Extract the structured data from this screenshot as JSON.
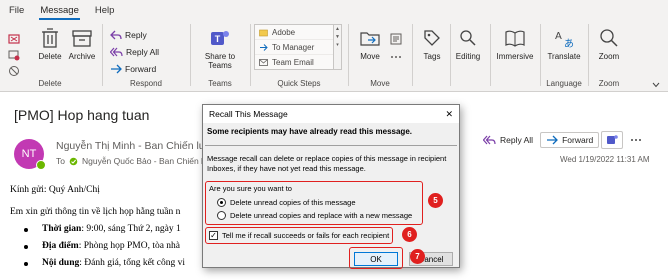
{
  "menu": {
    "tabs": [
      "File",
      "Message",
      "Help"
    ],
    "active": "Message"
  },
  "ribbon": {
    "delete_group": {
      "label": "Delete",
      "delete": "Delete",
      "archive": "Archive"
    },
    "respond_group": {
      "label": "Respond",
      "reply": "Reply",
      "reply_all": "Reply All",
      "forward": "Forward"
    },
    "teams_group": {
      "label": "Teams",
      "share_line1": "Share to",
      "share_line2": "Teams"
    },
    "quick_steps": {
      "label": "Quick Steps",
      "items": [
        "Adobe",
        "To Manager",
        "Team Email"
      ]
    },
    "move_group": {
      "label": "Move",
      "move": "Move"
    },
    "tags": {
      "label": "Tags"
    },
    "editing": {
      "label": "Editing"
    },
    "immersive": {
      "label": "Immersive"
    },
    "language_group": {
      "label": "Language",
      "translate": "Translate"
    },
    "zoom_group": {
      "label": "Zoom",
      "zoom": "Zoom"
    }
  },
  "message": {
    "subject": "[PMO] Hop hang tuan",
    "avatar_initials": "NT",
    "sender": "Nguyễn Thị Minh - Ban Chiến lược",
    "to_label": "To",
    "to_recipient": "Nguyễn Quốc Bảo - Ban Chiến lược",
    "actions": {
      "reply_all": "Reply All",
      "forward": "Forward"
    },
    "datetime": "Wed 1/19/2022 11:31 AM",
    "body": {
      "greeting": "Kính gửi: Quý Anh/Chị",
      "intro": "Em xin gửi thông tin về lịch họp hằng tuần n",
      "bullets": [
        {
          "label": "Thời gian",
          "text": ": 9:00, sáng Thứ 2, ngày 1"
        },
        {
          "label": "Địa điểm",
          "text": ": Phòng họp PMO, tòa nhà"
        },
        {
          "label": "Nội dung",
          "text": ": Đánh giá, tổng kết công vi"
        }
      ]
    }
  },
  "dialog": {
    "title": "Recall This Message",
    "close_glyph": "✕",
    "warning": "Some recipients may have already read this message.",
    "info_line1": "Message recall can delete or replace copies of this message in recipient",
    "info_line2": "Inboxes, if they have not yet read this message.",
    "question": "Are you sure you want to",
    "option1": "Delete unread copies of this message",
    "option2": "Delete unread copies and replace with a new message",
    "checkbox_label": "Tell me if recall succeeds or fails for each recipient",
    "ok": "OK",
    "cancel": "Cancel"
  },
  "annotations": {
    "step5": "5",
    "step6": "6",
    "step7": "7"
  },
  "colors": {
    "accent": "#0f6cbd",
    "annotation_red": "#e0201f",
    "avatar": "#c239b3",
    "presence": "#6bb700"
  }
}
